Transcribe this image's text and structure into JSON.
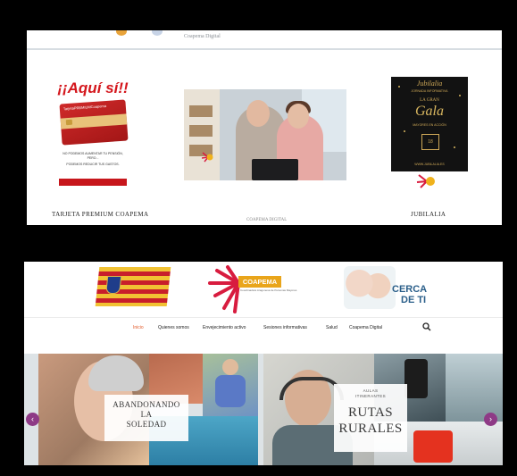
{
  "top_site": {
    "header_subtitle": "Coapema Digital",
    "cards": [
      {
        "headline": "¡¡Aquí sí!!",
        "card_name": "TarjetaPREMIUMCoapema",
        "fine_print_1": "NO PODEMOS AUMENTAR TU PENSIÓN, PERO...",
        "fine_print_2": "PODEMOS REDUCIR TUS GASTOS.",
        "caption": "TARJETA PREMIUM COAPEMA"
      },
      {
        "caption": "COAPEMA DIGITAL"
      },
      {
        "brand": "Jubilalia",
        "subtitle": "JORNADA INFORMATIVA",
        "line1": "LA GRAN",
        "line2": "Gala",
        "line3": "MAYORES EN ACCIÓN",
        "date": "18",
        "url": "WWW.JUBILALIA.ES",
        "caption": "JUBILALIA"
      }
    ]
  },
  "bottom_site": {
    "logo": {
      "name": "COAPEMA",
      "tagline": "Coordinadora Aragonesa de Personas Mayores"
    },
    "cerca": {
      "line1": "CERCA",
      "line2": "DE TI"
    },
    "nav": [
      "Inicio",
      "Quienes somos",
      "Envejecimiento activo",
      "Sesiones informativas",
      "Salud",
      "Coapema Digital"
    ],
    "slides": {
      "left": [
        "ABANDONANDO",
        "LA",
        "SOLEDAD"
      ],
      "right_small": [
        "AULAS",
        "ITINERANTES"
      ],
      "right_big": [
        "RUTAS",
        "RURALES"
      ]
    },
    "arrows": {
      "prev": "‹",
      "next": "›"
    },
    "colors": {
      "accent_orange": "#e25b2a",
      "arrow_purple": "#8e3a86",
      "coapema_orange": "#e9a51b"
    }
  }
}
